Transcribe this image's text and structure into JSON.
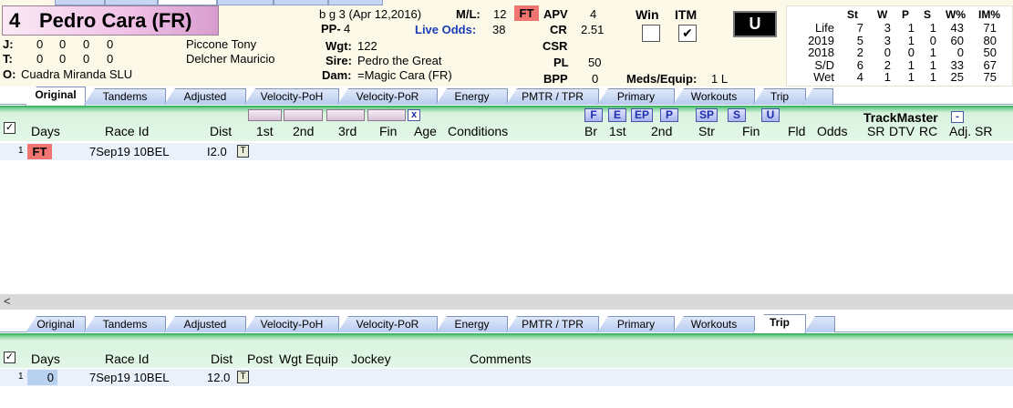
{
  "horse": {
    "number": "4",
    "name": "Pedro Cara (FR)",
    "desc": "b g 3 (Apr 12,2016)",
    "pp_label": "PP-",
    "pp": "4",
    "wgt_label": "Wgt:",
    "wgt": "122",
    "sire_label": "Sire:",
    "sire": "Pedro the Great",
    "dam_label": "Dam:",
    "dam": "=Magic Cara (FR)"
  },
  "connections": {
    "j_label": "J:",
    "j_stats": [
      "0",
      "0",
      "0",
      "0"
    ],
    "jockey": "Piccone Tony",
    "t_label": "T:",
    "t_stats": [
      "0",
      "0",
      "0",
      "0"
    ],
    "trainer": "Delcher Mauricio",
    "o_label": "O:",
    "owner": "Cuadra Miranda SLU"
  },
  "odds": {
    "ml_label": "M/L:",
    "ml": "12",
    "live_label": "Live Odds:",
    "live": "38",
    "surface_badge": "FT"
  },
  "ratings": {
    "apv_label": "APV",
    "apv": "4",
    "cr_label": "CR",
    "cr": "2.51",
    "csr_label": "CSR",
    "csr": "",
    "pl_label": "PL",
    "pl": "50",
    "bpp_label": "BPP",
    "bpp": "0"
  },
  "bets": {
    "win_label": "Win",
    "itm_label": "ITM",
    "itm_check": "✔",
    "u_label": "U",
    "meds_label": "Meds/Equip:",
    "meds": "1 L"
  },
  "stats": {
    "headers": [
      "St",
      "W",
      "P",
      "S",
      "W%",
      "IM%"
    ],
    "rows": [
      {
        "label": "Life",
        "vals": [
          "7",
          "3",
          "1",
          "1",
          "43",
          "71"
        ]
      },
      {
        "label": "2019",
        "vals": [
          "5",
          "3",
          "1",
          "0",
          "60",
          "80"
        ]
      },
      {
        "label": "2018",
        "vals": [
          "2",
          "0",
          "0",
          "1",
          "0",
          "50"
        ]
      },
      {
        "label": "S/D",
        "vals": [
          "6",
          "2",
          "1",
          "1",
          "33",
          "67"
        ]
      },
      {
        "label": "Wet",
        "vals": [
          "4",
          "1",
          "1",
          "1",
          "25",
          "75"
        ]
      }
    ]
  },
  "tabs_top": [
    "Original",
    "Tandems",
    "Adjusted",
    "Velocity-PoH",
    "Velocity-PoR",
    "Energy",
    "PMTR / TPR",
    "Primary",
    "Workouts",
    "Trip"
  ],
  "tabs_bottom": [
    "Original",
    "Tandems",
    "Adjusted",
    "Velocity-PoH",
    "Velocity-PoR",
    "Energy",
    "PMTR / TPR",
    "Primary",
    "Workouts",
    "Trip"
  ],
  "top_grid": {
    "check": "✓",
    "headers": {
      "days": "Days",
      "race_id": "Race Id",
      "dist": "Dist",
      "first": "1st",
      "second": "2nd",
      "third": "3rd",
      "fin": "Fin",
      "age": "Age",
      "conditions": "Conditions",
      "br": "Br",
      "first2": "1st",
      "second2": "2nd",
      "str": "Str",
      "fin2": "Fin",
      "fld": "Fld",
      "odds": "Odds",
      "trackmaster": "TrackMaster",
      "sr": "SR",
      "dtv": "DTV",
      "rc": "RC",
      "adj_sr": "Adj. SR"
    },
    "pace_buttons": [
      "F",
      "E",
      "EP",
      "P",
      "SP",
      "S",
      "U"
    ],
    "x_btn": "x",
    "minus_btn": "-",
    "rows": [
      {
        "idx": "1",
        "days": "FT",
        "race_id": "7Sep19 10BEL",
        "dist": "I2.0",
        "t": "T"
      }
    ]
  },
  "bottom_grid": {
    "check": "✓",
    "headers": {
      "days": "Days",
      "race_id": "Race Id",
      "dist": "Dist",
      "post": "Post",
      "wgt": "Wgt",
      "equip": "Equip",
      "jockey": "Jockey",
      "comments": "Comments"
    },
    "rows": [
      {
        "idx": "1",
        "days": "0",
        "race_id": "7Sep19 10BEL",
        "dist": "12.0",
        "t": "T"
      }
    ]
  },
  "scroll_arrow": "<"
}
